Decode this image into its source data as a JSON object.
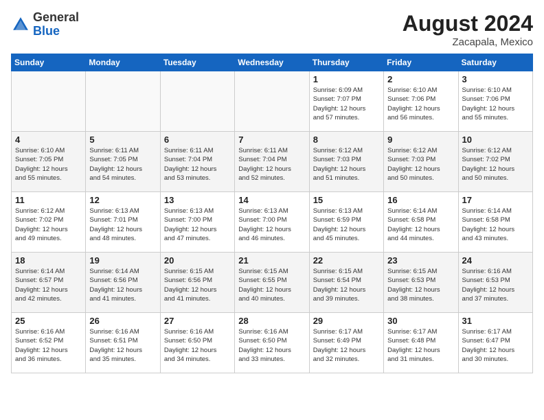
{
  "header": {
    "logo_general": "General",
    "logo_blue": "Blue",
    "month_year": "August 2024",
    "location": "Zacapala, Mexico"
  },
  "weekdays": [
    "Sunday",
    "Monday",
    "Tuesday",
    "Wednesday",
    "Thursday",
    "Friday",
    "Saturday"
  ],
  "weeks": [
    [
      {
        "day": "",
        "info": ""
      },
      {
        "day": "",
        "info": ""
      },
      {
        "day": "",
        "info": ""
      },
      {
        "day": "",
        "info": ""
      },
      {
        "day": "1",
        "info": "Sunrise: 6:09 AM\nSunset: 7:07 PM\nDaylight: 12 hours\nand 57 minutes."
      },
      {
        "day": "2",
        "info": "Sunrise: 6:10 AM\nSunset: 7:06 PM\nDaylight: 12 hours\nand 56 minutes."
      },
      {
        "day": "3",
        "info": "Sunrise: 6:10 AM\nSunset: 7:06 PM\nDaylight: 12 hours\nand 55 minutes."
      }
    ],
    [
      {
        "day": "4",
        "info": "Sunrise: 6:10 AM\nSunset: 7:05 PM\nDaylight: 12 hours\nand 55 minutes."
      },
      {
        "day": "5",
        "info": "Sunrise: 6:11 AM\nSunset: 7:05 PM\nDaylight: 12 hours\nand 54 minutes."
      },
      {
        "day": "6",
        "info": "Sunrise: 6:11 AM\nSunset: 7:04 PM\nDaylight: 12 hours\nand 53 minutes."
      },
      {
        "day": "7",
        "info": "Sunrise: 6:11 AM\nSunset: 7:04 PM\nDaylight: 12 hours\nand 52 minutes."
      },
      {
        "day": "8",
        "info": "Sunrise: 6:12 AM\nSunset: 7:03 PM\nDaylight: 12 hours\nand 51 minutes."
      },
      {
        "day": "9",
        "info": "Sunrise: 6:12 AM\nSunset: 7:03 PM\nDaylight: 12 hours\nand 50 minutes."
      },
      {
        "day": "10",
        "info": "Sunrise: 6:12 AM\nSunset: 7:02 PM\nDaylight: 12 hours\nand 50 minutes."
      }
    ],
    [
      {
        "day": "11",
        "info": "Sunrise: 6:12 AM\nSunset: 7:02 PM\nDaylight: 12 hours\nand 49 minutes."
      },
      {
        "day": "12",
        "info": "Sunrise: 6:13 AM\nSunset: 7:01 PM\nDaylight: 12 hours\nand 48 minutes."
      },
      {
        "day": "13",
        "info": "Sunrise: 6:13 AM\nSunset: 7:00 PM\nDaylight: 12 hours\nand 47 minutes."
      },
      {
        "day": "14",
        "info": "Sunrise: 6:13 AM\nSunset: 7:00 PM\nDaylight: 12 hours\nand 46 minutes."
      },
      {
        "day": "15",
        "info": "Sunrise: 6:13 AM\nSunset: 6:59 PM\nDaylight: 12 hours\nand 45 minutes."
      },
      {
        "day": "16",
        "info": "Sunrise: 6:14 AM\nSunset: 6:58 PM\nDaylight: 12 hours\nand 44 minutes."
      },
      {
        "day": "17",
        "info": "Sunrise: 6:14 AM\nSunset: 6:58 PM\nDaylight: 12 hours\nand 43 minutes."
      }
    ],
    [
      {
        "day": "18",
        "info": "Sunrise: 6:14 AM\nSunset: 6:57 PM\nDaylight: 12 hours\nand 42 minutes."
      },
      {
        "day": "19",
        "info": "Sunrise: 6:14 AM\nSunset: 6:56 PM\nDaylight: 12 hours\nand 41 minutes."
      },
      {
        "day": "20",
        "info": "Sunrise: 6:15 AM\nSunset: 6:56 PM\nDaylight: 12 hours\nand 41 minutes."
      },
      {
        "day": "21",
        "info": "Sunrise: 6:15 AM\nSunset: 6:55 PM\nDaylight: 12 hours\nand 40 minutes."
      },
      {
        "day": "22",
        "info": "Sunrise: 6:15 AM\nSunset: 6:54 PM\nDaylight: 12 hours\nand 39 minutes."
      },
      {
        "day": "23",
        "info": "Sunrise: 6:15 AM\nSunset: 6:53 PM\nDaylight: 12 hours\nand 38 minutes."
      },
      {
        "day": "24",
        "info": "Sunrise: 6:16 AM\nSunset: 6:53 PM\nDaylight: 12 hours\nand 37 minutes."
      }
    ],
    [
      {
        "day": "25",
        "info": "Sunrise: 6:16 AM\nSunset: 6:52 PM\nDaylight: 12 hours\nand 36 minutes."
      },
      {
        "day": "26",
        "info": "Sunrise: 6:16 AM\nSunset: 6:51 PM\nDaylight: 12 hours\nand 35 minutes."
      },
      {
        "day": "27",
        "info": "Sunrise: 6:16 AM\nSunset: 6:50 PM\nDaylight: 12 hours\nand 34 minutes."
      },
      {
        "day": "28",
        "info": "Sunrise: 6:16 AM\nSunset: 6:50 PM\nDaylight: 12 hours\nand 33 minutes."
      },
      {
        "day": "29",
        "info": "Sunrise: 6:17 AM\nSunset: 6:49 PM\nDaylight: 12 hours\nand 32 minutes."
      },
      {
        "day": "30",
        "info": "Sunrise: 6:17 AM\nSunset: 6:48 PM\nDaylight: 12 hours\nand 31 minutes."
      },
      {
        "day": "31",
        "info": "Sunrise: 6:17 AM\nSunset: 6:47 PM\nDaylight: 12 hours\nand 30 minutes."
      }
    ]
  ]
}
